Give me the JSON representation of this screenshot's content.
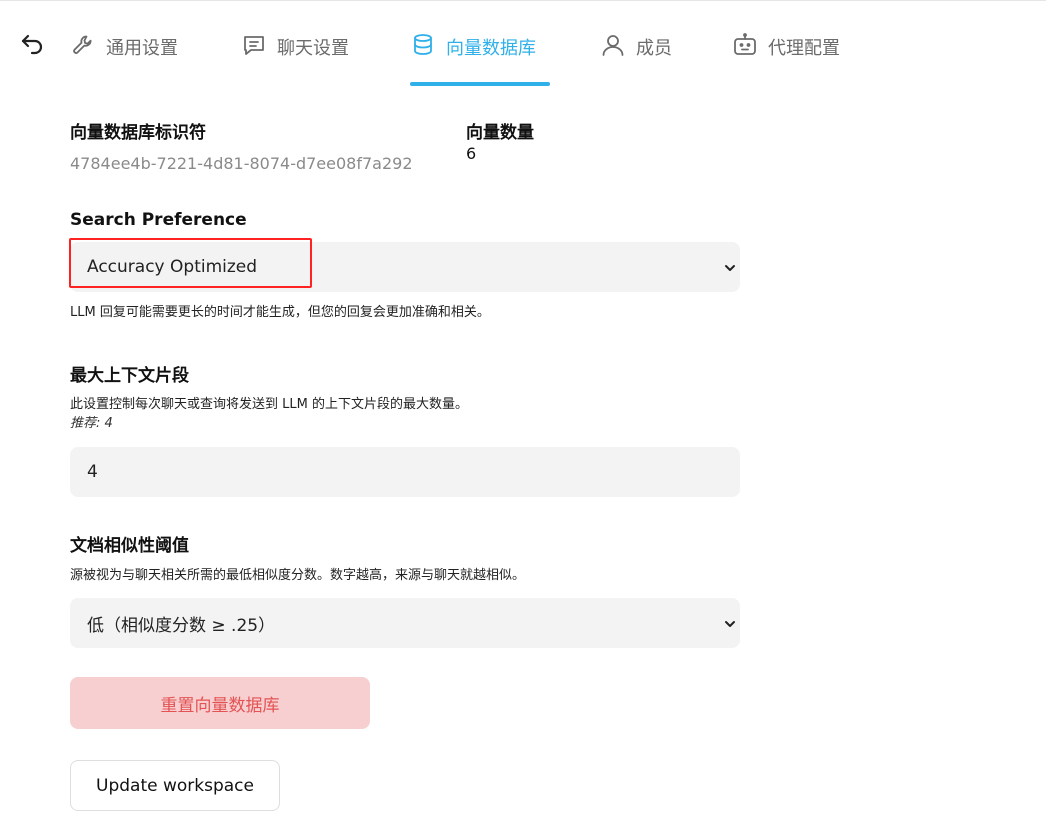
{
  "nav": {
    "tabs": [
      {
        "label": "通用设置",
        "icon": "wrench-icon"
      },
      {
        "label": "聊天设置",
        "icon": "chat-icon"
      },
      {
        "label": "向量数据库",
        "icon": "database-icon",
        "active": true
      },
      {
        "label": "成员",
        "icon": "user-icon"
      },
      {
        "label": "代理配置",
        "icon": "robot-icon"
      }
    ]
  },
  "vectordb": {
    "id_label": "向量数据库标识符",
    "id_value": "4784ee4b-7221-4d81-8074-d7ee08f7a292",
    "count_label": "向量数量",
    "count_value": "6"
  },
  "search_preference": {
    "label": "Search Preference",
    "selected": "Accuracy Optimized",
    "help": "LLM 回复可能需要更长的时间才能生成，但您的回复会更加准确和相关。"
  },
  "max_context": {
    "label": "最大上下文片段",
    "help": "此设置控制每次聊天或查询将发送到 LLM 的上下文片段的最大数量。",
    "recommended": "推荐: 4",
    "value": "4"
  },
  "similarity": {
    "label": "文档相似性阈值",
    "help": "源被视为与聊天相关所需的最低相似度分数。数字越高，来源与聊天就越相似。",
    "selected": "低（相似度分数 ≥ .25）"
  },
  "buttons": {
    "reset": "重置向量数据库",
    "update": "Update workspace"
  },
  "colors": {
    "accent": "#2fb0e8",
    "danger_bg": "#f8cfd0",
    "danger_text": "#e35353",
    "highlight_box": "#ff2222"
  }
}
